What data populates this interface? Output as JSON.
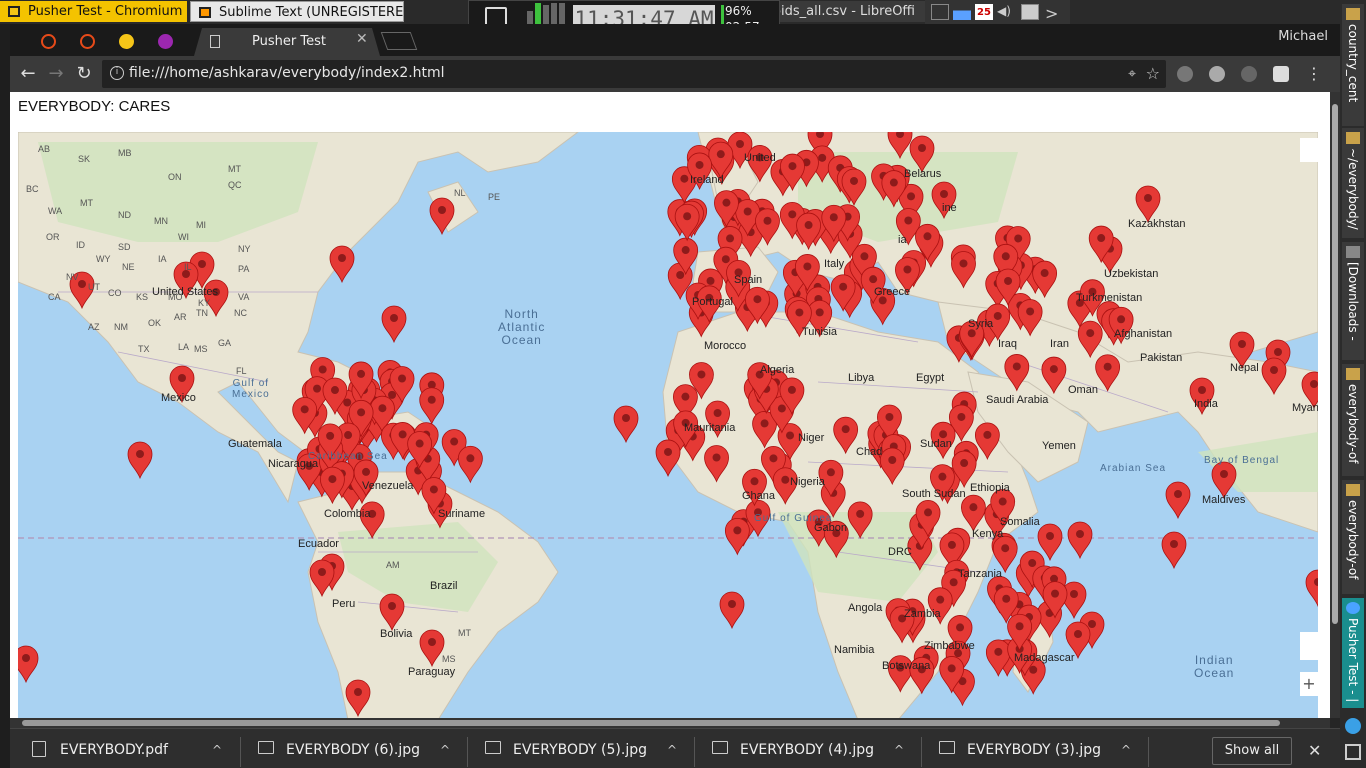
{
  "taskbar": {
    "chromium_item": "Pusher Test - Chromium",
    "sublime_item": "Sublime Text (UNREGISTERED)",
    "libre_item": "eroids_all.csv - LibreOffi",
    "clock": "11:31:47 AM",
    "battery_percent": "96%",
    "battery_time": "02:57",
    "calendar_day": "25"
  },
  "sidepanel": {
    "tabs": [
      "country_cent",
      "~/everybody/",
      "[Downloads -",
      "everybody-of",
      "everybody-of",
      "Pusher Test - |"
    ]
  },
  "browser": {
    "tab_title": "Pusher Test",
    "profile_name": "Michael",
    "url": "file:///home/ashkarav/everybody/index2.html"
  },
  "page": {
    "title": "EVERYBODY: CARES"
  },
  "map": {
    "ocean_labels": [
      {
        "text": "North\nAtlantic\nOcean"
      },
      {
        "text": "Gulf of\nMexico"
      },
      {
        "text": "Arabian Sea"
      },
      {
        "text": "Bay of Bengal"
      },
      {
        "text": "Indian\nOcean"
      },
      {
        "text": "Caribbean Sea"
      },
      {
        "text": "Gulf of Guinea"
      }
    ],
    "place_labels": [
      "United States",
      "Mexico",
      "Ireland",
      "United",
      "Belarus",
      "Kazakhstan",
      "Uzbekistan",
      "Turkmenistan",
      "Afghanistan",
      "Pakistan",
      "Nepal",
      "India",
      "Myan",
      "Portugal",
      "Spain",
      "Italy",
      "Greece",
      "Tunisia",
      "Morocco",
      "Algeria",
      "Libya",
      "Egypt",
      "Saudi Arabia",
      "Iraq",
      "Iran",
      "Oman",
      "Yemen",
      "Sudan",
      "Chad",
      "Niger",
      "Nigeria",
      "Ghana",
      "Mauritania",
      "Ethiopia",
      "Somalia",
      "Kenya",
      "Tanzania",
      "DRC",
      "Gabon",
      "Angola",
      "Zambia",
      "Zimbabwe",
      "Namibia",
      "Botswana",
      "Madagascar",
      "Venezuela",
      "Colombia",
      "Ecuador",
      "Peru",
      "Brazil",
      "Bolivia",
      "Paraguay",
      "Suriname",
      "Nicaragua",
      "Guatemala",
      "South Sudan",
      "Syria",
      "Maldives",
      "ine",
      "ia"
    ],
    "state_abbrs": [
      "AB",
      "SK",
      "MB",
      "ON",
      "QC",
      "BC",
      "WA",
      "MT",
      "ND",
      "MN",
      "WI",
      "MI",
      "NY",
      "OR",
      "ID",
      "WY",
      "SD",
      "NE",
      "IA",
      "IL",
      "PA",
      "NV",
      "UT",
      "CO",
      "KS",
      "MO",
      "KY",
      "VA",
      "AZ",
      "NM",
      "OK",
      "AR",
      "TN",
      "NC",
      "TX",
      "LA",
      "MS",
      "GA",
      "FL",
      "CA",
      "NL",
      "MT",
      "PE",
      "AM",
      "MT",
      "MS"
    ]
  },
  "downloads": {
    "items": [
      "EVERYBODY.pdf",
      "EVERYBODY (6).jpg",
      "EVERYBODY (5).jpg",
      "EVERYBODY (4).jpg",
      "EVERYBODY (3).jpg"
    ],
    "show_all": "Show all"
  },
  "colors": {
    "marker": "#e53935",
    "marker_core": "#8e1b1b",
    "water": "#a9d2f2",
    "land": "#e9e5d4",
    "green": "#cfe4bd",
    "chrome_yellow_task": "#f4c300"
  },
  "markers": {
    "count_visible": 260
  }
}
